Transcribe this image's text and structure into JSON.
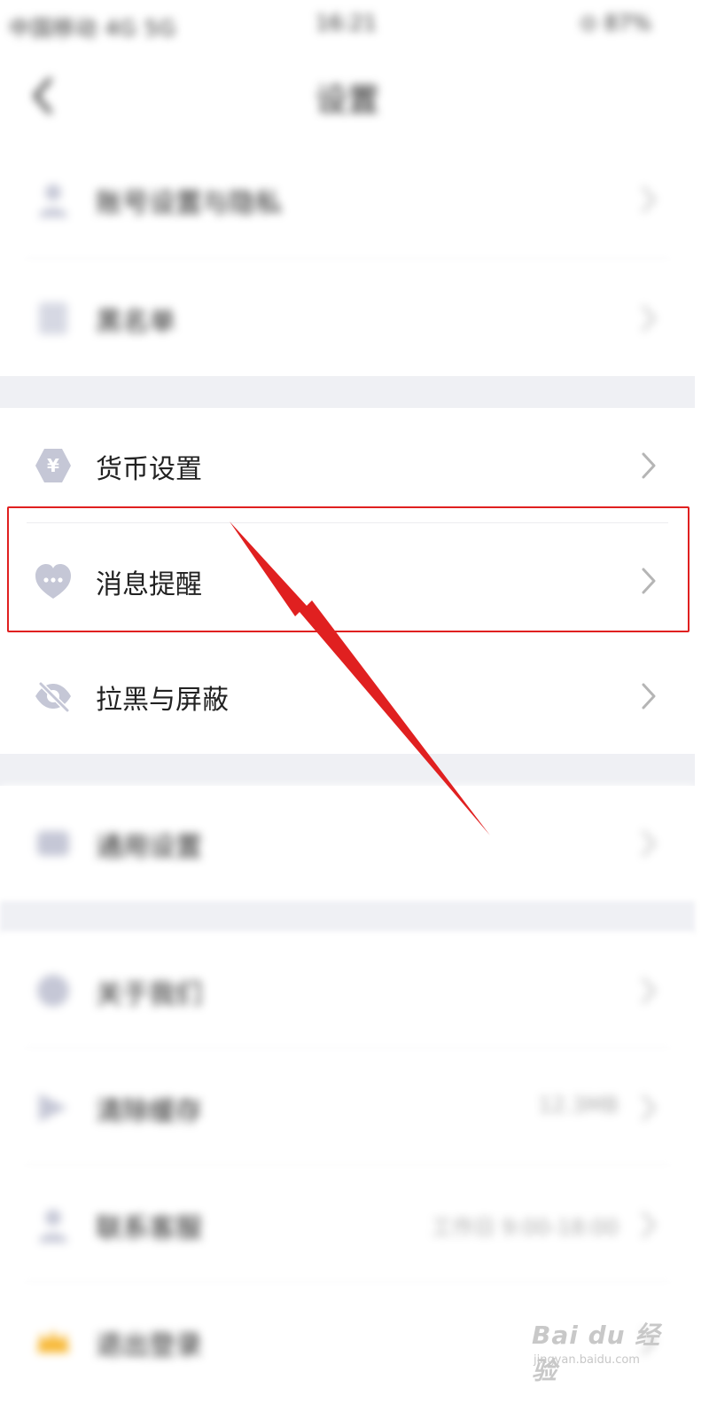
{
  "status_bar": {
    "left_text": "中国移动 4G 5G",
    "time": "16:21",
    "right_text": "⊙ 87%"
  },
  "header": {
    "title": "设置"
  },
  "items": [
    {
      "label": "账号设置与隐私",
      "icon": "user-icon"
    },
    {
      "label": "黑名单",
      "icon": "list-icon"
    },
    {
      "label": "货币设置",
      "icon": "yen-hexagon-icon"
    },
    {
      "label": "消息提醒",
      "icon": "chat-heart-icon"
    },
    {
      "label": "拉黑与屏蔽",
      "icon": "eye-off-icon"
    },
    {
      "label": "通用设置",
      "icon": "sliders-icon"
    },
    {
      "label": "关于我们",
      "icon": "info-icon"
    },
    {
      "label": "清除缓存",
      "icon": "broom-icon",
      "value": "12.3MB"
    },
    {
      "label": "联系客服",
      "icon": "headset-icon",
      "value": "工作日 9:00-18:00"
    },
    {
      "label": "退出登录",
      "icon": "crown-icon"
    }
  ],
  "watermark": {
    "main": "Bai du 经验",
    "sub": "jingyan.baidu.com"
  },
  "colors": {
    "icon": "#c5c7d6",
    "highlight": "#e02020",
    "separator": "#eff0f4"
  }
}
